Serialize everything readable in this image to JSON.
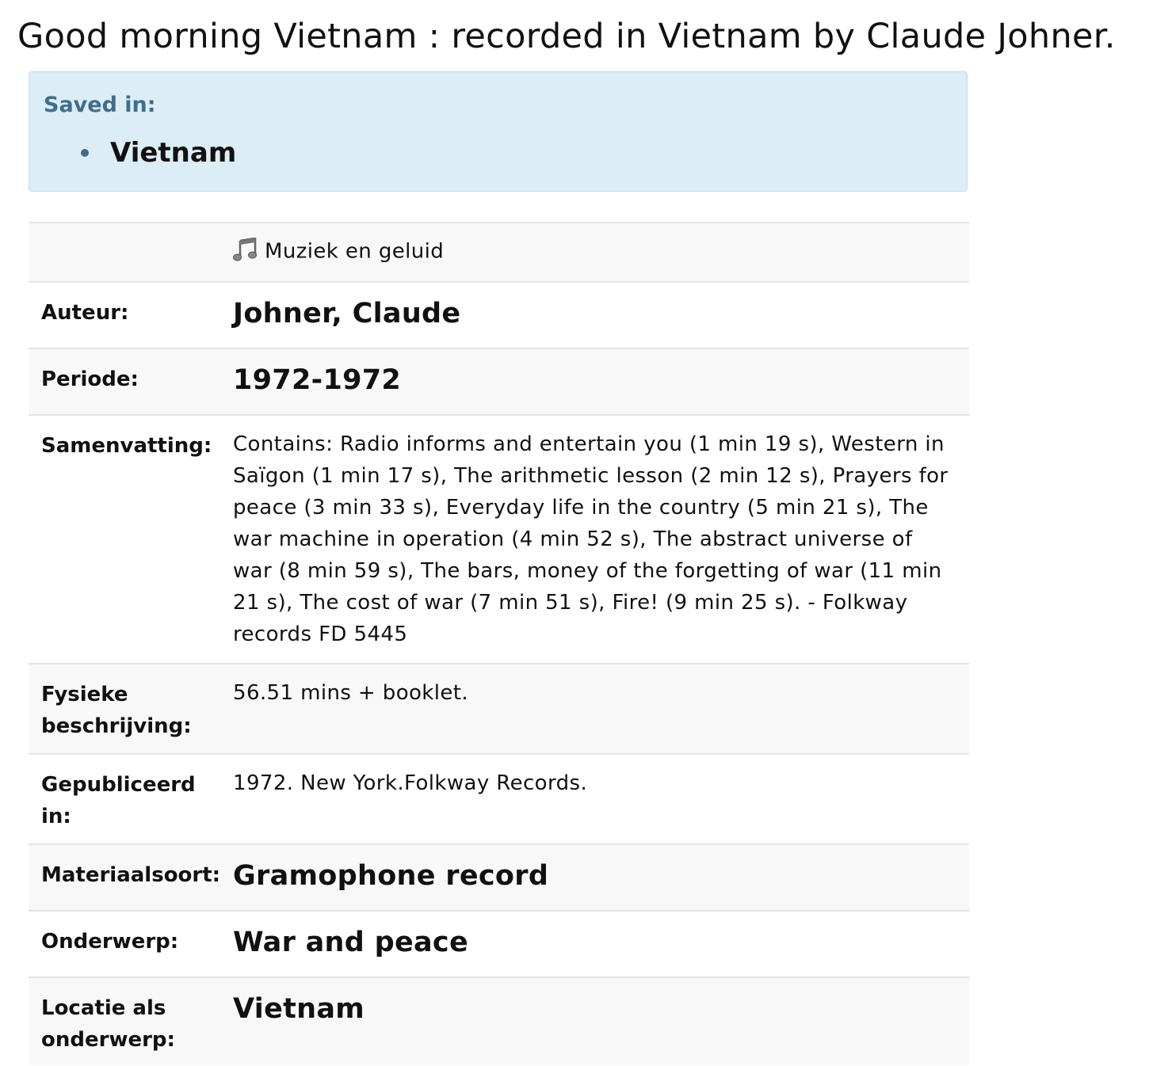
{
  "page": {
    "title": "Good morning Vietnam : recorded in Vietnam by Claude Johner."
  },
  "saved_in": {
    "label": "Saved in:",
    "items": [
      "Vietnam"
    ]
  },
  "record": {
    "type": {
      "icon": "music-notes-icon",
      "label": "Muziek en geluid"
    },
    "fields": [
      {
        "label": "Auteur:",
        "value": "Johner, Claude"
      },
      {
        "label": "Periode:",
        "value": "1972-1972"
      },
      {
        "label": "Samenvatting:",
        "value": "Contains: Radio informs and entertain you (1 min 19 s), Western in Saïgon (1 min 17 s), The arithmetic lesson (2 min 12 s), Prayers for peace (3 min 33 s), Everyday life in the country (5 min 21 s), The war machine in operation (4 min 52 s), The abstract universe of war (8 min 59 s), The bars, money of the forgetting of war (11 min 21 s), The cost of war (7 min 51 s), Fire! (9 min 25 s). - Folkway records FD 5445"
      },
      {
        "label": "Fysieke beschrijving:",
        "value": "56.51 mins + booklet."
      },
      {
        "label": "Gepubliceerd in:",
        "value": "1972. New York.Folkway Records."
      },
      {
        "label": "Materiaalsoort:",
        "value": "Gramophone record"
      },
      {
        "label": "Onderwerp:",
        "value": "War and peace"
      },
      {
        "label": "Locatie als onderwerp:",
        "value": "Vietnam"
      }
    ]
  },
  "colors": {
    "saved_box_bg": "#ddedf5",
    "saved_label": "#3f6d8d",
    "row_shade": "#f8f8f8",
    "divider": "#e4e4e4"
  }
}
